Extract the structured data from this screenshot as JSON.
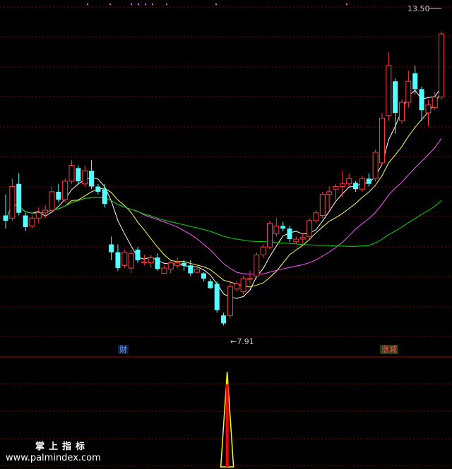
{
  "chart_data": {
    "type": "candlestick",
    "price_range": [
      7.5,
      13.8
    ],
    "annotations": {
      "high_label": "13.50",
      "low_label": "7.91"
    },
    "candles": [
      [
        10.0,
        10.4,
        9.75,
        9.9
      ],
      [
        9.95,
        10.7,
        9.9,
        10.55
      ],
      [
        10.6,
        10.8,
        10.0,
        10.05
      ],
      [
        10.0,
        10.05,
        9.7,
        9.78
      ],
      [
        9.8,
        10.0,
        9.75,
        9.95
      ],
      [
        9.95,
        10.15,
        9.85,
        10.05
      ],
      [
        10.05,
        10.2,
        9.95,
        10.1
      ],
      [
        10.1,
        10.55,
        10.05,
        10.45
      ],
      [
        10.45,
        10.6,
        10.25,
        10.3
      ],
      [
        10.3,
        10.7,
        10.25,
        10.65
      ],
      [
        10.65,
        11.05,
        10.6,
        10.95
      ],
      [
        10.9,
        10.95,
        10.6,
        10.65
      ],
      [
        10.6,
        10.95,
        10.55,
        10.85
      ],
      [
        10.85,
        11.05,
        10.5,
        10.55
      ],
      [
        10.55,
        10.6,
        10.4,
        10.45
      ],
      [
        10.5,
        10.6,
        10.15,
        10.22
      ],
      [
        9.45,
        9.6,
        9.15,
        9.3
      ],
      [
        9.3,
        9.45,
        8.95,
        9.0
      ],
      [
        9.05,
        9.35,
        9.0,
        9.3
      ],
      [
        9.0,
        9.35,
        8.9,
        9.28
      ],
      [
        9.35,
        9.4,
        9.1,
        9.15
      ],
      [
        9.1,
        9.25,
        9.05,
        9.12
      ],
      [
        9.1,
        9.25,
        9.0,
        9.2
      ],
      [
        9.2,
        9.28,
        8.95,
        8.98
      ],
      [
        8.9,
        9.05,
        8.9,
        9.0
      ],
      [
        8.98,
        9.15,
        8.9,
        9.1
      ],
      [
        9.05,
        9.2,
        9.0,
        9.1
      ],
      [
        9.1,
        9.15,
        8.95,
        9.05
      ],
      [
        9.05,
        9.15,
        8.85,
        8.9
      ],
      [
        8.92,
        9.05,
        8.9,
        8.98
      ],
      [
        8.9,
        8.92,
        8.75,
        8.8
      ],
      [
        8.75,
        8.8,
        8.6,
        8.62
      ],
      [
        8.7,
        8.75,
        8.15,
        8.2
      ],
      [
        8.1,
        8.15,
        7.91,
        7.95
      ],
      [
        8.1,
        8.75,
        8.05,
        8.65
      ],
      [
        8.6,
        8.75,
        8.55,
        8.7
      ],
      [
        8.55,
        8.85,
        8.5,
        8.8
      ],
      [
        8.8,
        8.95,
        8.7,
        8.8
      ],
      [
        8.85,
        9.3,
        8.8,
        9.25
      ],
      [
        9.25,
        9.45,
        9.2,
        9.4
      ],
      [
        9.4,
        9.9,
        9.35,
        9.85
      ],
      [
        9.65,
        9.95,
        9.6,
        9.8
      ],
      [
        9.8,
        9.88,
        9.7,
        9.75
      ],
      [
        9.75,
        9.8,
        9.5,
        9.55
      ],
      [
        9.5,
        9.6,
        9.45,
        9.55
      ],
      [
        9.55,
        9.65,
        9.45,
        9.58
      ],
      [
        9.6,
        9.95,
        9.55,
        9.9
      ],
      [
        9.9,
        10.1,
        9.85,
        10.05
      ],
      [
        10.0,
        10.45,
        9.95,
        10.4
      ],
      [
        10.4,
        10.55,
        10.1,
        10.45
      ],
      [
        10.5,
        10.6,
        10.3,
        10.55
      ],
      [
        10.55,
        10.85,
        10.35,
        10.6
      ],
      [
        10.6,
        10.8,
        10.55,
        10.7
      ],
      [
        10.62,
        10.65,
        10.45,
        10.5
      ],
      [
        10.5,
        10.75,
        10.45,
        10.7
      ],
      [
        10.7,
        10.8,
        10.55,
        10.6
      ],
      [
        10.7,
        11.25,
        10.65,
        11.2
      ],
      [
        11.0,
        11.95,
        10.95,
        11.85
      ],
      [
        11.9,
        13.1,
        11.8,
        12.85
      ],
      [
        12.55,
        12.6,
        11.55,
        11.95
      ],
      [
        11.8,
        12.2,
        11.75,
        12.15
      ],
      [
        12.15,
        12.75,
        12.05,
        12.55
      ],
      [
        12.7,
        12.85,
        12.3,
        12.4
      ],
      [
        12.4,
        12.45,
        11.8,
        12.0
      ],
      [
        11.95,
        12.2,
        11.7,
        12.1
      ],
      [
        12.05,
        12.35,
        12.0,
        12.25
      ],
      [
        12.25,
        13.5,
        12.2,
        13.45
      ]
    ],
    "indicator": {
      "zd_range": [
        0,
        100
      ],
      "spike_index": 39
    }
  },
  "badges": {
    "cai": "财",
    "zhangjian": "涨减"
  },
  "watermark": {
    "line1": "掌上指标",
    "line2": "www.palmindex.com"
  },
  "colors": {
    "up": "#ff3c3c",
    "down": "#54ffff",
    "ma5": "#ffffff",
    "ma10": "#ffff54",
    "ma20": "#ff54ff",
    "ma60": "#00dd00",
    "grid": "#8b0000",
    "spike": "#ff0000"
  }
}
